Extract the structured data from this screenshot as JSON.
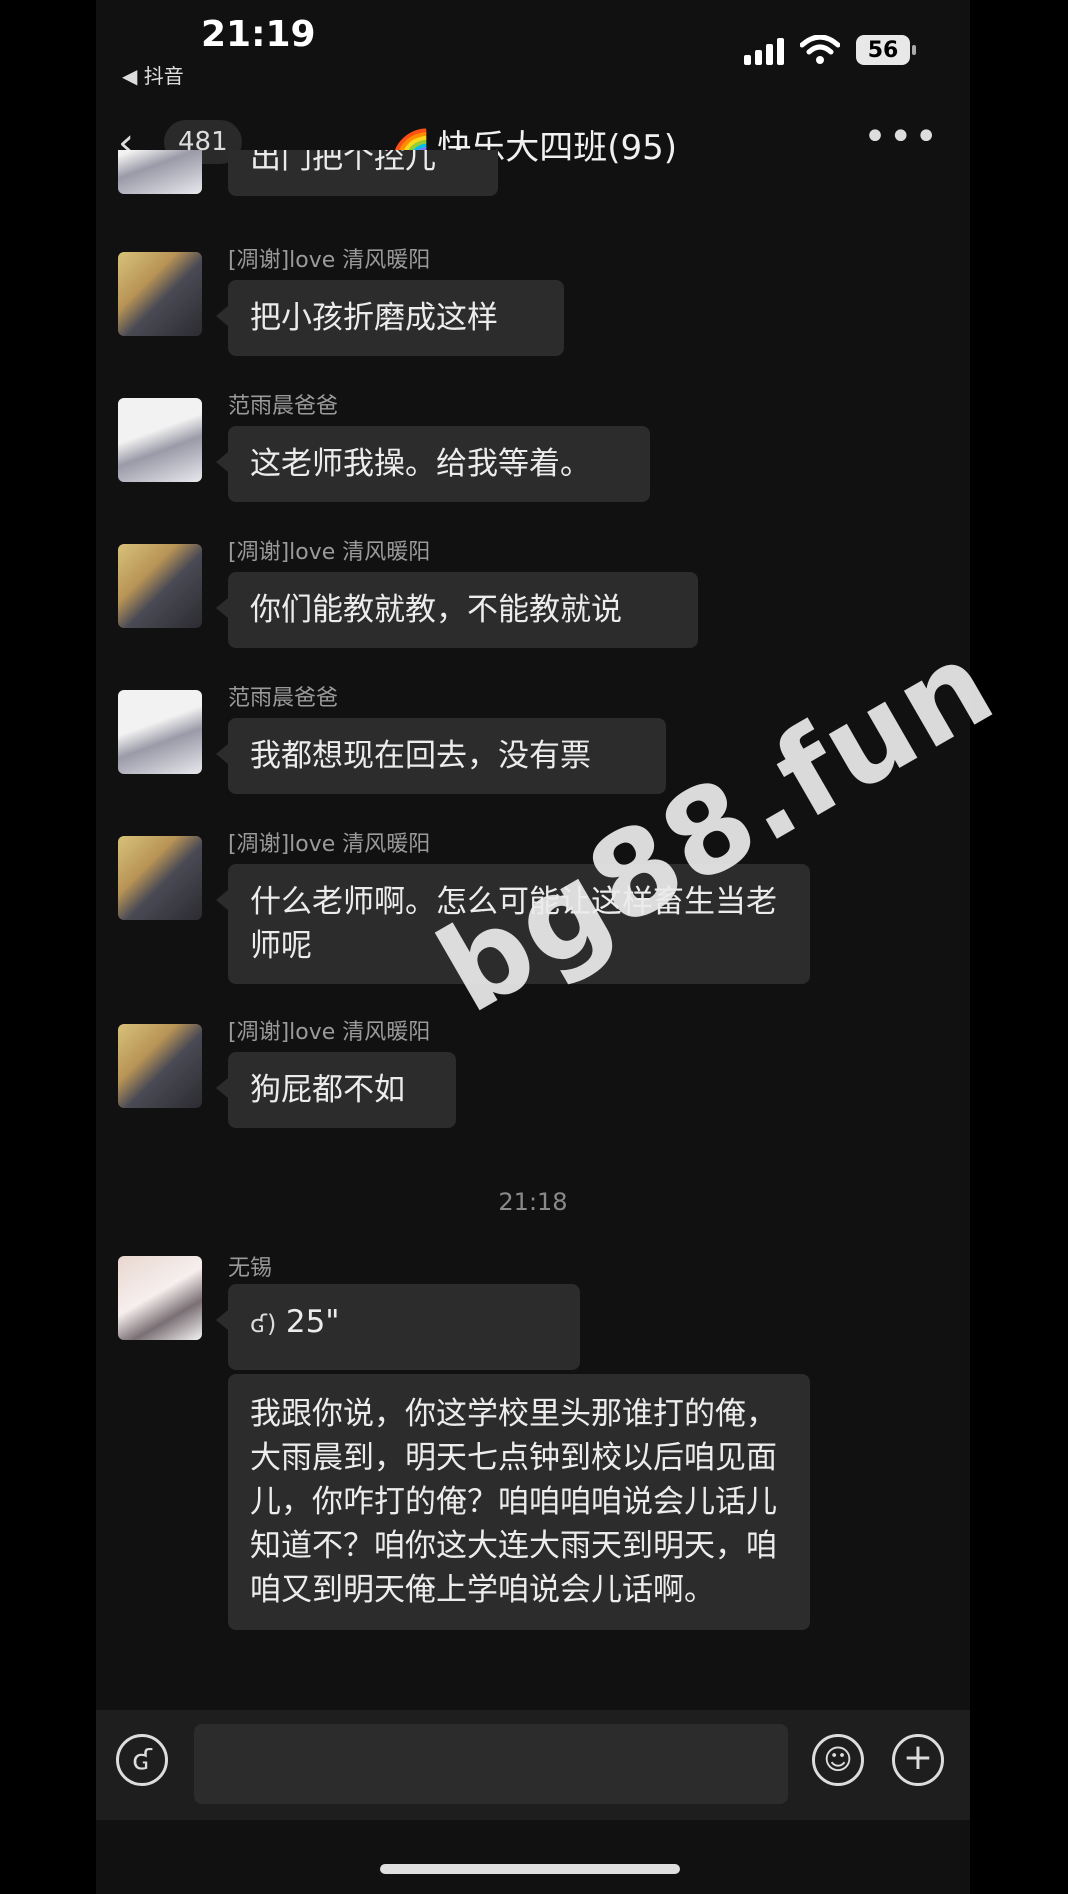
{
  "status_bar": {
    "time": "21:19",
    "back_app": "◀ 抖音",
    "battery": "56"
  },
  "header": {
    "back_count": "481",
    "title": "快乐大四班(95)",
    "title_emoji": "🌈"
  },
  "messages": [
    {
      "sender": "",
      "text": "出门把个控儿"
    },
    {
      "sender": "[凋谢]love 清风暖阳",
      "text": "把小孩折磨成这样"
    },
    {
      "sender": "范雨晨爸爸",
      "text": "这老师我操。给我等着。"
    },
    {
      "sender": "[凋谢]love 清风暖阳",
      "text": "你们能教就教，不能教就说"
    },
    {
      "sender": "范雨晨爸爸",
      "text": "我都想现在回去，没有票"
    },
    {
      "sender": "[凋谢]love 清风暖阳",
      "text": "什么老师啊。怎么可能让这样畜生当老师呢"
    },
    {
      "sender": "[凋谢]love 清风暖阳",
      "text": "狗屁都不如"
    }
  ],
  "time_divider": "21:18",
  "voice_message": {
    "sender": "无锡",
    "duration": "25\"",
    "transcript": "我跟你说，你这学校里头那谁打的俺，大雨晨到，明天七点钟到校以后咱见面儿，你咋打的俺？咱咱咱咱说会儿话儿知道不？咱你这大连大雨天到明天，咱咱又到明天俺上学咱说会儿话啊。"
  },
  "watermark": "bg88.fun",
  "icons": {
    "voice": "voice-icon",
    "emoji": "emoji-icon",
    "plus": "plus-icon",
    "back": "chevron-left-icon",
    "more": "more-icon"
  }
}
